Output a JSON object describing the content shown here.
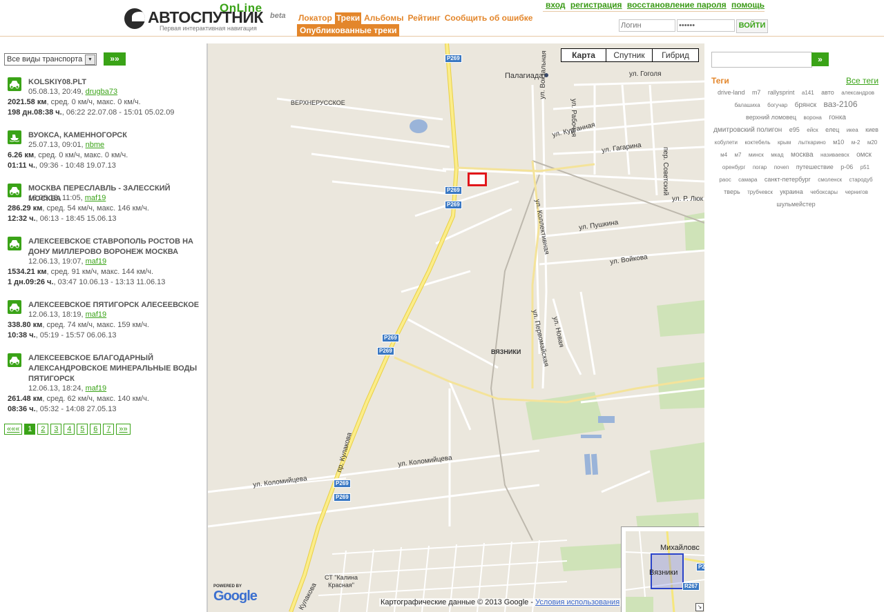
{
  "header": {
    "logo": {
      "online": "OnLine",
      "title": "АВТОСПУТНИК",
      "beta": "beta",
      "subtitle": "Первая интерактивная навигация"
    },
    "nav": [
      "Локатор",
      "Треки",
      "Альбомы",
      "Рейтинг",
      "Сообщить об ошибке"
    ],
    "active_nav": "Треки",
    "subnav": "Опубликованные треки",
    "user_links": [
      "вход",
      "регистрация",
      "восстановление пароля",
      "помощь"
    ],
    "login_placeholder": "Логин",
    "password_value": "••••••",
    "login_button": "ВОЙТИ"
  },
  "filter": {
    "transport_selected": "Все виды транспорта",
    "go_label": "»»"
  },
  "tracks": [
    {
      "title": "KOLSKIY08.PLT",
      "date": "05.08.13, 20:49,",
      "user": "drugba73",
      "distance": "2021.58 км",
      "speeds": ", сред. 0 км/ч, макс. 0 км/ч.",
      "duration": "198 дн.08:38 ч.",
      "period": ", 06:22 22.07.08 - 15:01 05.02.09",
      "icon": "car-icon"
    },
    {
      "title": "ВУОКСА, КАМЕННОГОРСК",
      "date": "25.07.13, 09:01,",
      "user": "nbme",
      "distance": "6.26 км",
      "speeds": ", сред. 0 км/ч, макс. 0 км/ч.",
      "duration": "01:11 ч.",
      "period": ", 09:36 - 10:48 19.07.13",
      "icon": "boat-icon"
    },
    {
      "title": "МОСКВА ПЕРЕСЛАВЛЬ - ЗАЛЕССКИЙ МОСКВА",
      "date": "16.06.13, 11:05,",
      "user": "maf19",
      "distance": "286.29 км",
      "speeds": ", сред. 54 км/ч, макс. 146 км/ч.",
      "duration": "12:32 ч.",
      "period": ", 06:13 - 18:45 15.06.13",
      "icon": "car-icon"
    },
    {
      "title": "АЛЕКСЕЕВСКОЕ СТАВРОПОЛЬ РОСТОВ НА ДОНУ МИЛЛЕРОВО ВОРОНЕЖ МОСКВА",
      "date": "12.06.13, 19:07,",
      "user": "maf19",
      "distance": "1534.21 км",
      "speeds": ", сред. 91 км/ч, макс. 144 км/ч.",
      "duration": "1 дн.09:26 ч.",
      "period": ", 03:47 10.06.13 - 13:13 11.06.13",
      "icon": "car-icon"
    },
    {
      "title": "АЛЕКСЕЕВСКОЕ ПЯТИГОРСК АЛЕСЕЕВСКОЕ",
      "date": "12.06.13, 18:19,",
      "user": "maf19",
      "distance": "338.80 км",
      "speeds": ", сред. 74 км/ч, макс. 159 км/ч.",
      "duration": "10:38 ч.",
      "period": ", 05:19 - 15:57 06.06.13",
      "icon": "car-icon"
    },
    {
      "title": "АЛЕКСЕЕВСКОЕ БЛАГОДАРНЫЙ АЛЕКСАНДРОВСКОЕ МИНЕРАЛЬНЫЕ ВОДЫ ПЯТИГОРСК",
      "date": "12.06.13, 18:24,",
      "user": "maf19",
      "distance": "261.48 км",
      "speeds": ", сред. 62 км/ч, макс. 140 км/ч.",
      "duration": "08:36 ч.",
      "period": ", 05:32 - 14:08 27.05.13",
      "icon": "car-icon"
    }
  ],
  "pager": [
    "«««",
    "1",
    "2",
    "3",
    "4",
    "5",
    "6",
    "7",
    "»»"
  ],
  "pager_active": "1",
  "map": {
    "types": [
      "Карта",
      "Спутник",
      "Гибрид"
    ],
    "active_type": "Карта",
    "labels": {
      "palagiada": "Палагиада",
      "verkhnerusskoe": "ВЕРХНЕРУССКОЕ",
      "gogolya": "ул. Гоголя",
      "rabochaya": "ул. Рабочая",
      "vokzalnaya": "ул. Вокзальная",
      "kurgannaya": "ул. Курганная",
      "gagarina": "ул. Гагарина",
      "sovetskiy": "пер. Советский",
      "r_lyuk": "ул. Р. Люк",
      "kollektivnaya": "ул. Коллективная",
      "pushkina": "ул. Пушкина",
      "voykova": "ул. Войкова",
      "pervomayskaya": "ул. Первомайская",
      "novaya": "ул. Новая",
      "vyazniki": "ВЯЗНИКИ",
      "kulakova": "пр. Кулакова",
      "kolomiytseva1": "ул. Коломийцева",
      "kolomiytseva2": "ул. Коломийцева",
      "kalina": "СТ \"Калина Красная\"",
      "kulakova2": "Кулакова"
    },
    "road_shield": "P269",
    "google_powered": "POWERED BY",
    "google_word": "Google",
    "copyright": "Картографические данные © 2013 Google -",
    "terms": "Условия использования",
    "overview": {
      "city": "Вязники",
      "mikhailovsk": "Михайловс",
      "road": "R267",
      "road2": "P2"
    }
  },
  "sidebar": {
    "search_button": "»",
    "tags_heading": "Теги",
    "all_tags": "Все теги",
    "tags": [
      {
        "t": "drive-land",
        "s": 9
      },
      {
        "t": "m7",
        "s": 9
      },
      {
        "t": "rallysprint",
        "s": 9
      },
      {
        "t": "a141",
        "s": 8
      },
      {
        "t": "авто",
        "s": 9
      },
      {
        "t": "александров",
        "s": 8
      },
      {
        "t": "балашиха",
        "s": 8
      },
      {
        "t": "богучар",
        "s": 8
      },
      {
        "t": "брянск",
        "s": 10
      },
      {
        "t": "ваз-2106",
        "s": 12
      },
      {
        "t": "верхний ломовец",
        "s": 9
      },
      {
        "t": "ворона",
        "s": 8
      },
      {
        "t": "гонка",
        "s": 10
      },
      {
        "t": "дмитровский полигон",
        "s": 10
      },
      {
        "t": "е95",
        "s": 9
      },
      {
        "t": "ейск",
        "s": 8
      },
      {
        "t": "елец",
        "s": 9
      },
      {
        "t": "икеа",
        "s": 8
      },
      {
        "t": "киев",
        "s": 9
      },
      {
        "t": "кобулети",
        "s": 8
      },
      {
        "t": "коктебель",
        "s": 8
      },
      {
        "t": "крым",
        "s": 8
      },
      {
        "t": "лыткарино",
        "s": 8
      },
      {
        "t": "м10",
        "s": 9
      },
      {
        "t": "м-2",
        "s": 8
      },
      {
        "t": "м20",
        "s": 8
      },
      {
        "t": "м4",
        "s": 8
      },
      {
        "t": "м7",
        "s": 8
      },
      {
        "t": "минск",
        "s": 8
      },
      {
        "t": "мкад",
        "s": 8
      },
      {
        "t": "москва",
        "s": 10
      },
      {
        "t": "називаевск",
        "s": 8
      },
      {
        "t": "омск",
        "s": 10
      },
      {
        "t": "оренбург",
        "s": 8
      },
      {
        "t": "погар",
        "s": 8
      },
      {
        "t": "почеп",
        "s": 8
      },
      {
        "t": "путешествие",
        "s": 9
      },
      {
        "t": "р-06",
        "s": 9
      },
      {
        "t": "р51",
        "s": 8
      },
      {
        "t": "раос",
        "s": 8
      },
      {
        "t": "самара",
        "s": 8
      },
      {
        "t": "санкт-петербург",
        "s": 9
      },
      {
        "t": "смоленск",
        "s": 8
      },
      {
        "t": "стародуб",
        "s": 8
      },
      {
        "t": "тверь",
        "s": 9
      },
      {
        "t": "трубчевск",
        "s": 8
      },
      {
        "t": "украина",
        "s": 9
      },
      {
        "t": "чебоксары",
        "s": 8
      },
      {
        "t": "чернигов",
        "s": 8
      },
      {
        "t": "шульмейстер",
        "s": 9
      }
    ]
  },
  "colors": {
    "accent_orange": "#e3862b",
    "accent_green": "#3aa317",
    "map_bg": "#ebe7dd",
    "road_yellow": "#f6e77c"
  }
}
